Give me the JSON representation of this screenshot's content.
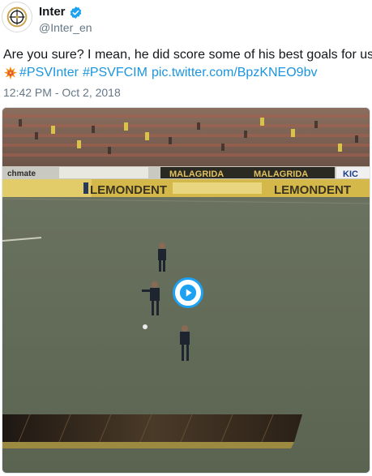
{
  "account": {
    "display_name": "Inter",
    "handle": "@Inter_en",
    "verified": true
  },
  "tweet": {
    "text_line1": "Are you sure? I mean, he did score some of his best goals for us!",
    "hashtag1": "#PSVInter",
    "hashtag2": "#PSVFCIM",
    "media_link": "pic.twitter.com/BpzKNEO9bv",
    "emoji": "collision-emoji",
    "timestamp": "12:42 PM - Oct 2, 2018"
  },
  "media": {
    "type": "video",
    "ad_boards_top": [
      "chmate",
      "MALAGRIDA",
      "MALAGRIDA",
      "KIC"
    ],
    "ad_boards_bottom": [
      "LEMONDENT",
      "LEMONDENT"
    ],
    "play_icon": "play-icon"
  },
  "colors": {
    "link": "#1b95e0",
    "verified": "#1da1f2",
    "secondary_text": "#657786",
    "play_ring": "#1da1f2"
  }
}
